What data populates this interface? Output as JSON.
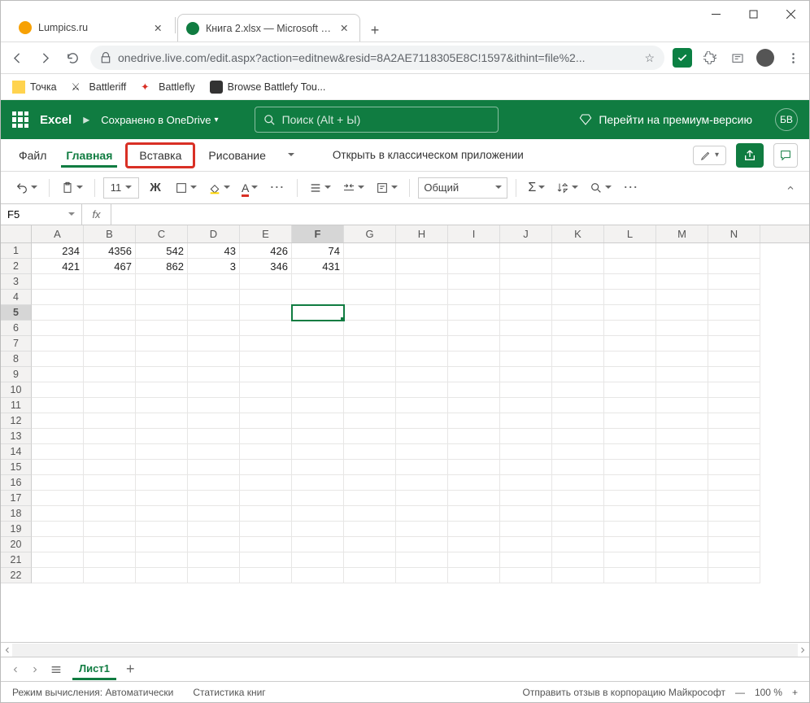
{
  "browser": {
    "tabs": [
      {
        "title": "Lumpics.ru",
        "fav": "#f7a104"
      },
      {
        "title": "Книга 2.xlsx — Microsoft Excel O",
        "fav": "#107c41"
      }
    ],
    "url": "onedrive.live.com/edit.aspx?action=editnew&resid=8A2AE7118305E8C!1597&ithint=file%2...",
    "bookmarks": [
      "Точка",
      "Battleriff",
      "Battlefly",
      "Browse Battlefy Tou..."
    ]
  },
  "excel": {
    "brand": "Excel",
    "saved": "Сохранено в OneDrive",
    "search_ph": "Поиск (Alt + Ы)",
    "premium": "Перейти на премиум-версию",
    "avatar": "БВ",
    "tabs": {
      "file": "Файл",
      "home": "Главная",
      "insert": "Вставка",
      "draw": "Рисование"
    },
    "open_classic": "Открыть в классическом приложении",
    "font_size": "11",
    "num_format": "Общий",
    "name_box": "F5",
    "sheet": "Лист1",
    "status_mode": "Режим вычисления: Автоматически",
    "status_stats": "Статистика книг",
    "status_feedback": "Отправить отзыв в корпорацию Майкрософт",
    "zoom": "100 %"
  },
  "columns": [
    "A",
    "B",
    "C",
    "D",
    "E",
    "F",
    "G",
    "H",
    "I",
    "J",
    "K",
    "L",
    "M",
    "N"
  ],
  "data": {
    "1": {
      "A": "234",
      "B": "4356",
      "C": "542",
      "D": "43",
      "E": "426",
      "F": "74"
    },
    "2": {
      "A": "421",
      "B": "467",
      "C": "862",
      "D": "3",
      "E": "346",
      "F": "431"
    }
  },
  "selected": {
    "row": 5,
    "col": "F"
  }
}
